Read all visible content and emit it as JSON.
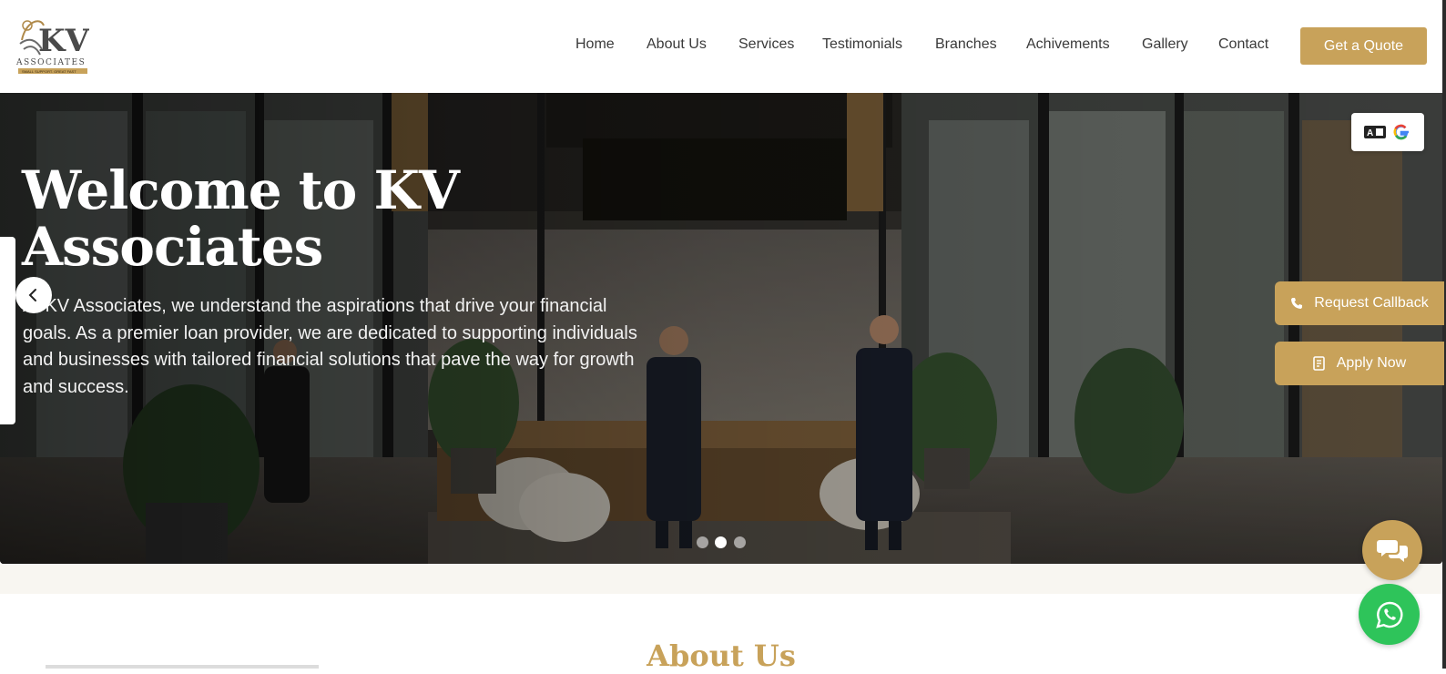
{
  "logo": {
    "monogram": "KV",
    "word": "ASSOCIATES",
    "tagline": "SMALL SUPPORT. GREAT FAST"
  },
  "nav": {
    "items": [
      "Home",
      "About Us",
      "Services",
      "Testimonials",
      "Branches",
      "Achivements",
      "Gallery",
      "Contact"
    ],
    "cta_label": "Get a Quote"
  },
  "hero": {
    "title": "Welcome to KV Associates",
    "description": "At KV Associates, we understand the aspirations that drive your financial goals. As a premier loan provider, we are dedicated to supporting individuals and businesses with tailored financial solutions that pave the way for growth and success.",
    "slides_total": 3,
    "active_slide": 2
  },
  "translate_widget": {
    "icon": "translate-icon",
    "brand_icon": "google-icon"
  },
  "side_actions": {
    "callback_label": "Request Callback",
    "callback_icon": "phone-icon",
    "apply_label": "Apply Now",
    "apply_icon": "document-icon"
  },
  "section": {
    "about_title": "About Us"
  },
  "floating": {
    "chat_icon": "chat-bubbles-icon",
    "whatsapp_icon": "whatsapp-icon"
  },
  "colors": {
    "accent": "#c8a25a",
    "whatsapp": "#2ec45a",
    "nav_text": "#3a3a3a"
  }
}
